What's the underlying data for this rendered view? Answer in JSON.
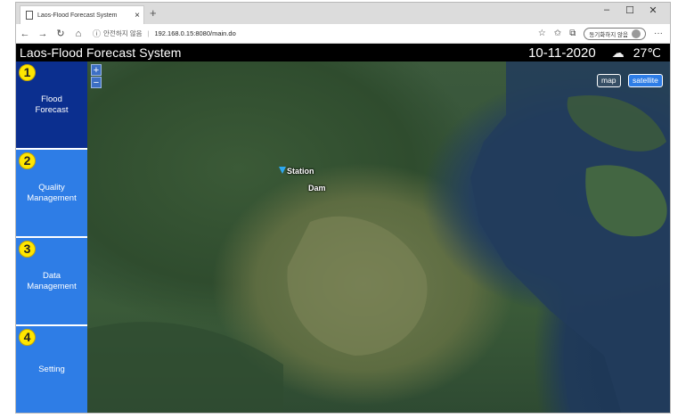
{
  "browser": {
    "tab_title": "Laos-Flood Forecast System",
    "tab_close": "×",
    "new_tab": "+",
    "window_controls": [
      "–",
      "☐",
      "✕"
    ],
    "nav": {
      "back": "←",
      "forward": "→",
      "refresh": "↻",
      "home": "⌂"
    },
    "security_icon": "ⓘ",
    "security_text": "안전하지 않음",
    "url": "192.168.0.15:8080/main.do",
    "toolbar_icons": [
      "☆",
      "✩",
      "⧉"
    ],
    "profile_text": "동기화하지 않음",
    "more": "···"
  },
  "header": {
    "title": "Laos-Flood Forecast System",
    "date": "10-11-2020",
    "weather_icon": "cloud-icon",
    "weather_glyph": "☁",
    "temperature": "27℃"
  },
  "sidebar": {
    "items": [
      {
        "number": "1",
        "label": "Flood Forecast",
        "active": true
      },
      {
        "number": "2",
        "label": "Quality Management",
        "active": false
      },
      {
        "number": "3",
        "label": "Data Management",
        "active": false
      },
      {
        "number": "4",
        "label": "Setting",
        "active": false
      }
    ]
  },
  "map": {
    "zoom_in": "+",
    "zoom_out": "−",
    "btn_map": "map",
    "btn_satellite": "satellite",
    "selected_layer": "satellite",
    "markers": [
      {
        "label": "Station"
      },
      {
        "label": "Dam"
      }
    ]
  },
  "colors": {
    "menu_active": "#0b2f8f",
    "menu_default": "#2e7de6",
    "number_badge": "#ffe600",
    "header_bg": "#000000"
  }
}
